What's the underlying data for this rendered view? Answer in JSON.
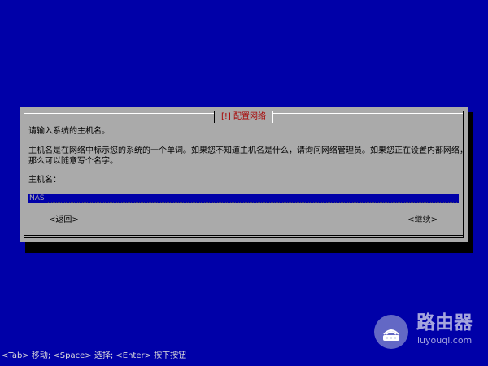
{
  "dialog": {
    "title": "[!] 配置网络",
    "prompt": "请输入系统的主机名。",
    "description": "主机名是在网络中标示您的系统的一个单词。如果您不知道主机名是什么，请询问网络管理员。如果您正在设置内部网络，那么可以随意写个名字。",
    "field_label": "主机名：",
    "hostname_value": "NAS",
    "back_button": "<返回>",
    "continue_button": "<继续>"
  },
  "footer": {
    "help": "<Tab> 移动; <Space> 选择; <Enter> 按下按钮"
  },
  "watermark": {
    "title": "路由器",
    "url": "luyouqi.com",
    "icon": "router-icon"
  },
  "colors": {
    "background": "#0000a8",
    "dialog": "#aaaaaa",
    "title": "#a80000",
    "input_background": "#0000a8"
  }
}
